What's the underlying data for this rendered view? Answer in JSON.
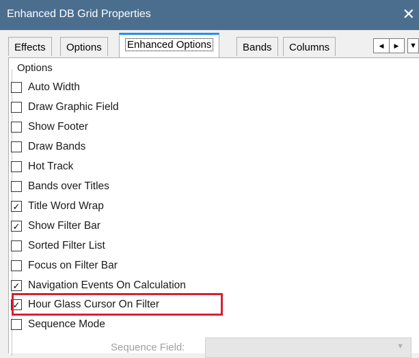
{
  "window": {
    "title": "Enhanced DB Grid Properties",
    "close_glyph": "✕"
  },
  "tabs": [
    {
      "label": "Effects",
      "active": false
    },
    {
      "label": "Options",
      "active": false
    },
    {
      "label": "Enhanced Options",
      "active": true
    },
    {
      "label": "Bands",
      "active": false
    },
    {
      "label": "Columns",
      "active": false
    }
  ],
  "tab_scroll": {
    "left_icon": "◀",
    "right_icon": "▶",
    "overflow_icon": "▼"
  },
  "group": {
    "label": "Options"
  },
  "options": [
    {
      "label": "Auto Width",
      "checked": false
    },
    {
      "label": "Draw Graphic Field",
      "checked": false
    },
    {
      "label": "Show Footer",
      "checked": false
    },
    {
      "label": "Draw Bands",
      "checked": false
    },
    {
      "label": "Hot Track",
      "checked": false
    },
    {
      "label": "Bands over Titles",
      "checked": false
    },
    {
      "label": "Title Word Wrap",
      "checked": true
    },
    {
      "label": "Show Filter Bar",
      "checked": true
    },
    {
      "label": "Sorted Filter List",
      "checked": false
    },
    {
      "label": "Focus on Filter Bar",
      "checked": false
    },
    {
      "label": "Navigation Events On Calculation",
      "checked": true
    },
    {
      "label": "Hour Glass Cursor On Filter",
      "checked": true,
      "highlighted": true
    },
    {
      "label": "Sequence Mode",
      "checked": false
    }
  ],
  "sequence_field": {
    "label": "Sequence Field:",
    "value": "",
    "disabled": true
  },
  "colors": {
    "titlebar": "#4b6e8f",
    "active_tab_accent": "#1e8ff3",
    "highlight": "#d62030"
  }
}
